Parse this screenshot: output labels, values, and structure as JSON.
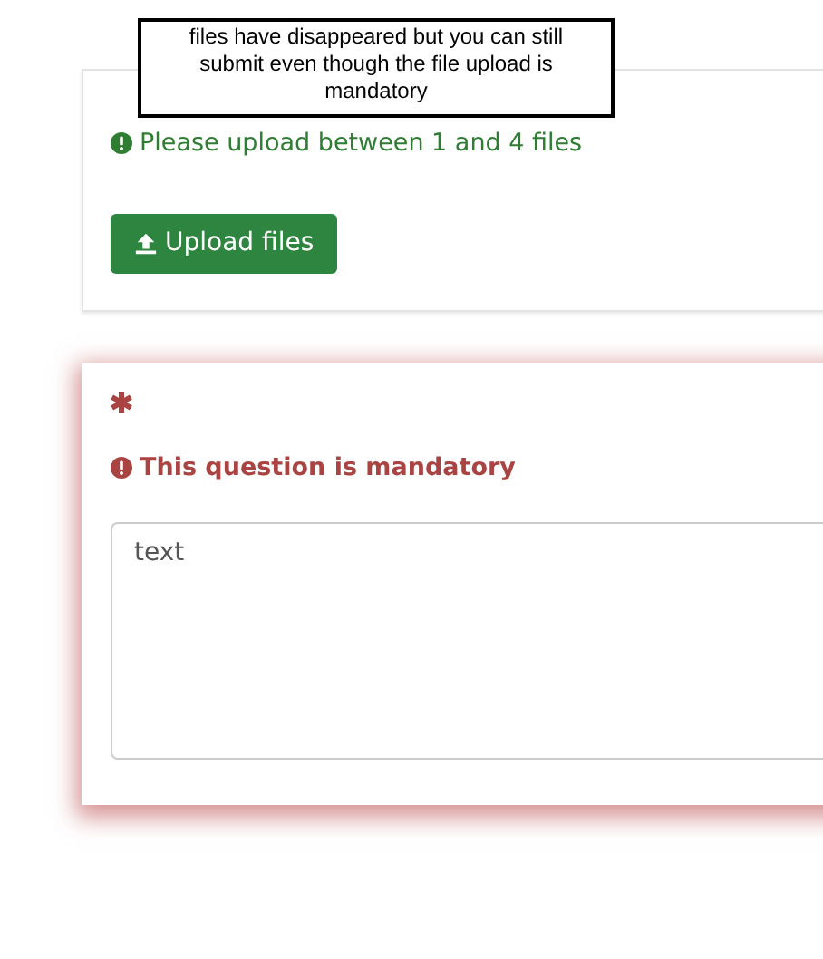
{
  "annotation": {
    "text": "files have disappeared but you can still submit even though the file upload is mandatory"
  },
  "upload_card": {
    "hint": "Please upload between 1 and 4 files",
    "button": "Upload files"
  },
  "question_card": {
    "required": true,
    "error": "This question is mandatory",
    "answer": {
      "value": "text"
    }
  }
}
